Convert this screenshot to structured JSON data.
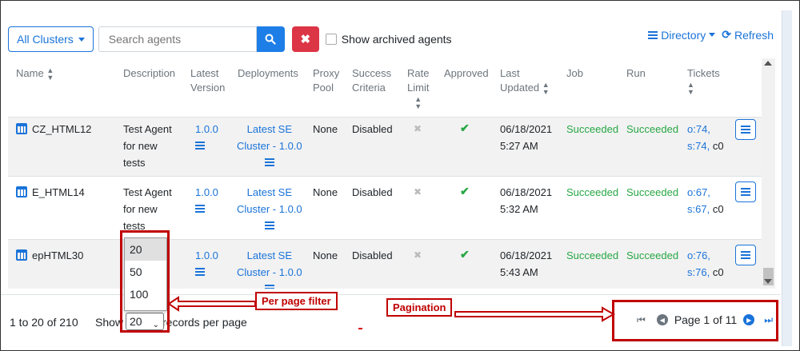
{
  "toolbar": {
    "clusters_label": "All Clusters",
    "search_placeholder": "Search agents",
    "archived_label": "Show archived agents",
    "directory_label": "Directory",
    "refresh_label": "Refresh"
  },
  "columns": {
    "name": "Name",
    "description": "Description",
    "latest_version": [
      "Latest",
      "Version"
    ],
    "deployments": "Deployments",
    "proxy_pool": [
      "Proxy",
      "Pool"
    ],
    "success_criteria": [
      "Success",
      "Criteria"
    ],
    "rate_limit": [
      "Rate",
      "Limit"
    ],
    "approved": "Approved",
    "last_updated": [
      "Last",
      "Updated"
    ],
    "job": "Job",
    "run": "Run",
    "tickets": "Tickets"
  },
  "rows": [
    {
      "name": "CZ_HTML12",
      "description": [
        "Test Agent",
        "for new",
        "tests"
      ],
      "version": "1.0.0",
      "deployment": [
        "Latest SE",
        "Cluster - 1.0.0"
      ],
      "proxy_pool": "None",
      "success_criteria": "Disabled",
      "updated": [
        "06/18/2021",
        "5:27 AM"
      ],
      "job": "Succeeded",
      "run": "Succeeded",
      "tickets": [
        "o:74,",
        "s:74,",
        "c0"
      ]
    },
    {
      "name": "E_HTML14",
      "description": [
        "Test Agent",
        "for new",
        "tests"
      ],
      "version": "1.0.0",
      "deployment": [
        "Latest SE",
        "Cluster - 1.0.0"
      ],
      "proxy_pool": "None",
      "success_criteria": "Disabled",
      "updated": [
        "06/18/2021",
        "5:32 AM"
      ],
      "job": "Succeeded",
      "run": "Succeeded",
      "tickets": [
        "o:67,",
        "s:67,",
        "c0"
      ]
    },
    {
      "name": "epHTML30",
      "description": [],
      "version": "1.0.0",
      "deployment": [
        "Latest SE",
        "Cluster - 1.0.0"
      ],
      "proxy_pool": "None",
      "success_criteria": "Disabled",
      "updated": [
        "06/18/2021",
        "5:43 AM"
      ],
      "job": "Succeeded",
      "run": "Succeeded",
      "tickets": [
        "o:76,",
        "s:76,",
        "c0"
      ]
    }
  ],
  "footer": {
    "range": "1 to 20 of 210",
    "show": "Show",
    "records": "records per page",
    "per_page_selected": "20",
    "per_page_options": [
      "20",
      "50",
      "100"
    ],
    "page_label": "Page 1 of 11"
  },
  "annotations": {
    "per_page_filter": "Per page filter",
    "pagination": "Pagination"
  },
  "colors": {
    "accent": "#1a73d9",
    "danger": "#dc3545",
    "success": "#28a745",
    "annotation": "#c00000"
  }
}
